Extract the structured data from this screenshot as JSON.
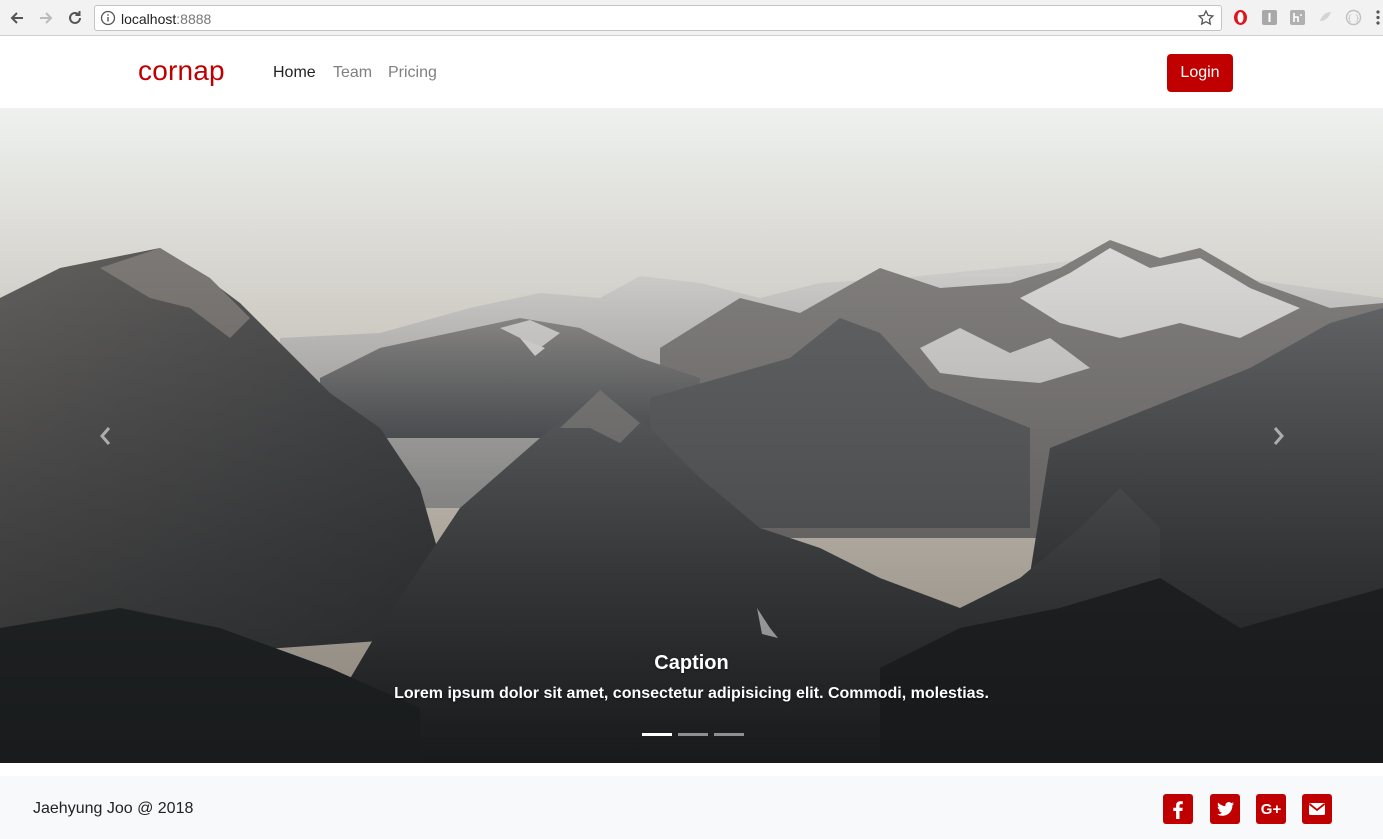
{
  "browser": {
    "url_host": "localhost",
    "url_port": ":8888",
    "icons": [
      "back-icon",
      "forward-icon",
      "reload-icon",
      "info-icon",
      "star-icon",
      "opera-icon",
      "extension-icon",
      "extension-icon",
      "extension-icon",
      "extension-icon",
      "menu-icon"
    ]
  },
  "navbar": {
    "brand": "cornap",
    "links": [
      {
        "label": "Home",
        "active": true
      },
      {
        "label": "Team",
        "active": false
      },
      {
        "label": "Pricing",
        "active": false
      }
    ],
    "login_label": "Login"
  },
  "carousel": {
    "caption_title": "Caption",
    "caption_text": "Lorem ipsum dolor sit amet, consectetur adipisicing elit. Commodi, molestias.",
    "slide_count": 3,
    "active_slide": 1,
    "prev_icon": "chevron-left-icon",
    "next_icon": "chevron-right-icon"
  },
  "footer": {
    "copyright": "Jaehyung Joo @ 2018",
    "social": [
      "facebook-icon",
      "twitter-icon",
      "google-plus-icon",
      "email-icon"
    ]
  },
  "colors": {
    "brand": "#c00000",
    "footer_bg": "#f8f9fa"
  }
}
